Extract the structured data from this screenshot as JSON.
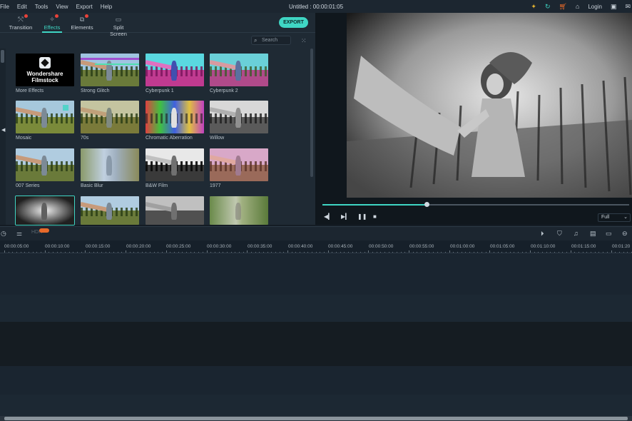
{
  "menubar": {
    "items": [
      "File",
      "Edit",
      "Tools",
      "View",
      "Export",
      "Help"
    ],
    "title": "Untitled : 00:00:01:05",
    "login": "Login"
  },
  "tabs": [
    {
      "label": "Transition",
      "icon": "transition-icon",
      "badge": true
    },
    {
      "label": "Effects",
      "icon": "effects-icon",
      "badge": true,
      "active": true
    },
    {
      "label": "Elements",
      "icon": "elements-icon",
      "badge": true
    },
    {
      "label": "Split Screen",
      "icon": "split-screen-icon",
      "badge": false
    }
  ],
  "export_label": "EXPORT",
  "search": {
    "placeholder": "Search"
  },
  "filmstock": {
    "line1": "Wondershare",
    "line2": "Filmstock"
  },
  "effects": [
    {
      "label": "More Effects"
    },
    {
      "label": "Strong Glitch"
    },
    {
      "label": "Cyberpunk 1"
    },
    {
      "label": "Cyberpunk 2"
    },
    {
      "label": "Mosaic"
    },
    {
      "label": "70s"
    },
    {
      "label": "Chromatic Aberration"
    },
    {
      "label": "Willow"
    },
    {
      "label": "007 Series"
    },
    {
      "label": "Basic Blur"
    },
    {
      "label": "B&W Film"
    },
    {
      "label": "1977"
    },
    {
      "label": ""
    },
    {
      "label": ""
    },
    {
      "label": ""
    },
    {
      "label": ""
    }
  ],
  "player": {
    "progress": 0.34,
    "quality": "Full"
  },
  "timeline": {
    "ruler": [
      "00:00:05:00",
      "00:00:10:00",
      "00:00:15:00",
      "00:00:20:00",
      "00:00:25:00",
      "00:00:30:00",
      "00:00:35:00",
      "00:00:40:00",
      "00:00:45:00",
      "00:00:50:00",
      "00:00:55:00",
      "00:01:00:00",
      "00:01:05:00",
      "00:01:10:00",
      "00:01:15:00",
      "00:01:20"
    ]
  },
  "colors": {
    "accent": "#3fd6c4",
    "badge": "#e8423a",
    "icon_gold": "#e0b030",
    "icon_orange": "#e86a2a"
  }
}
